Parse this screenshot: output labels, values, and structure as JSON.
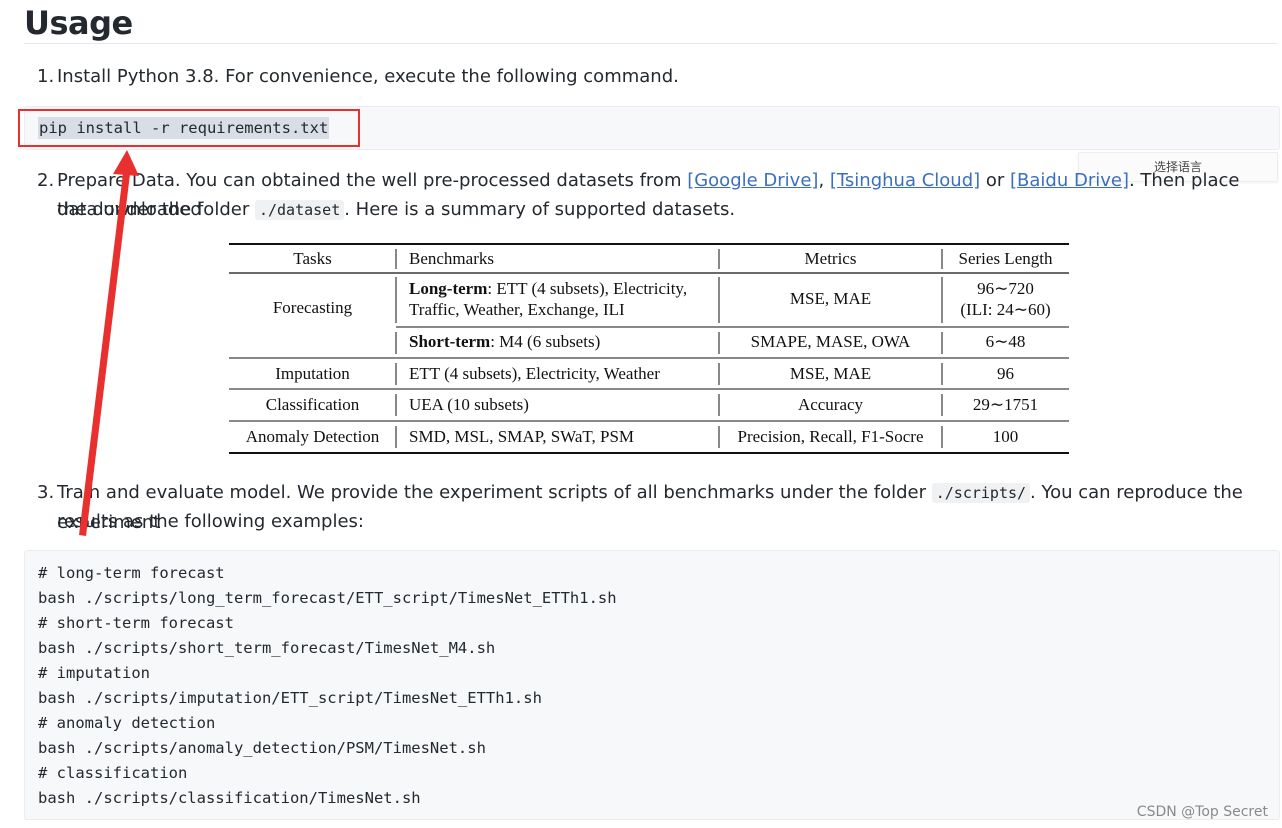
{
  "section": {
    "title": "Usage"
  },
  "step1": {
    "number": "1.",
    "text": "Install Python 3.8. For convenience, execute the following command."
  },
  "install_cmd": "pip install -r requirements.txt",
  "lang_selector": {
    "label": "选择语言"
  },
  "step2": {
    "number": "2.",
    "text_before": "Prepare Data. You can obtained the well pre-processed datasets from ",
    "link1": "[Google Drive]",
    "sep1": ", ",
    "link2": "[Tsinghua Cloud]",
    "sep2": " or ",
    "link3": "[Baidu Drive]",
    "text_after": ". Then place the downloaded",
    "line2_before": "data under the folder ",
    "folder": "./dataset",
    "line2_after": ". Here is a summary of supported datasets."
  },
  "table": {
    "headers": [
      "Tasks",
      "Benchmarks",
      "Metrics",
      "Series Length"
    ],
    "forecasting": {
      "task": "Forecasting",
      "long_label": "Long-term",
      "long_rest_1": ": ETT (4 subsets), Electricity,",
      "long_rest_2": "Traffic, Weather, Exchange, ILI",
      "long_metrics": "MSE, MAE",
      "long_length_1": "96∼720",
      "long_length_2": "(ILI: 24∼60)",
      "short_label": "Short-term",
      "short_rest": ": M4 (6 subsets)",
      "short_metrics": "SMAPE, MASE, OWA",
      "short_length": "6∼48"
    },
    "rows": [
      {
        "task": "Imputation",
        "bench": "ETT (4 subsets), Electricity, Weather",
        "metrics": "MSE, MAE",
        "length": "96"
      },
      {
        "task": "Classification",
        "bench": "UEA (10 subsets)",
        "metrics": "Accuracy",
        "length": "29∼1751"
      },
      {
        "task": "Anomaly Detection",
        "bench": "SMD, MSL, SMAP, SWaT, PSM",
        "metrics": "Precision, Recall, F1-Socre",
        "length": "100"
      }
    ]
  },
  "step3": {
    "number": "3.",
    "text_before": "Train and evaluate model. We provide the experiment scripts of all benchmarks under the folder ",
    "folder": "./scripts/",
    "text_after": ". You can reproduce the experiment",
    "line2": "results as the following examples:"
  },
  "scripts": [
    "# long-term forecast",
    "bash ./scripts/long_term_forecast/ETT_script/TimesNet_ETTh1.sh",
    "# short-term forecast",
    "bash ./scripts/short_term_forecast/TimesNet_M4.sh",
    "# imputation",
    "bash ./scripts/imputation/ETT_script/TimesNet_ETTh1.sh",
    "# anomaly detection",
    "bash ./scripts/anomaly_detection/PSM/TimesNet.sh",
    "# classification",
    "bash ./scripts/classification/TimesNet.sh"
  ],
  "watermark": "CSDN @Top Secret",
  "colors": {
    "annotation_red": "#e8312f",
    "link": "#3a6fbf",
    "code_bg": "#f6f8fa"
  }
}
